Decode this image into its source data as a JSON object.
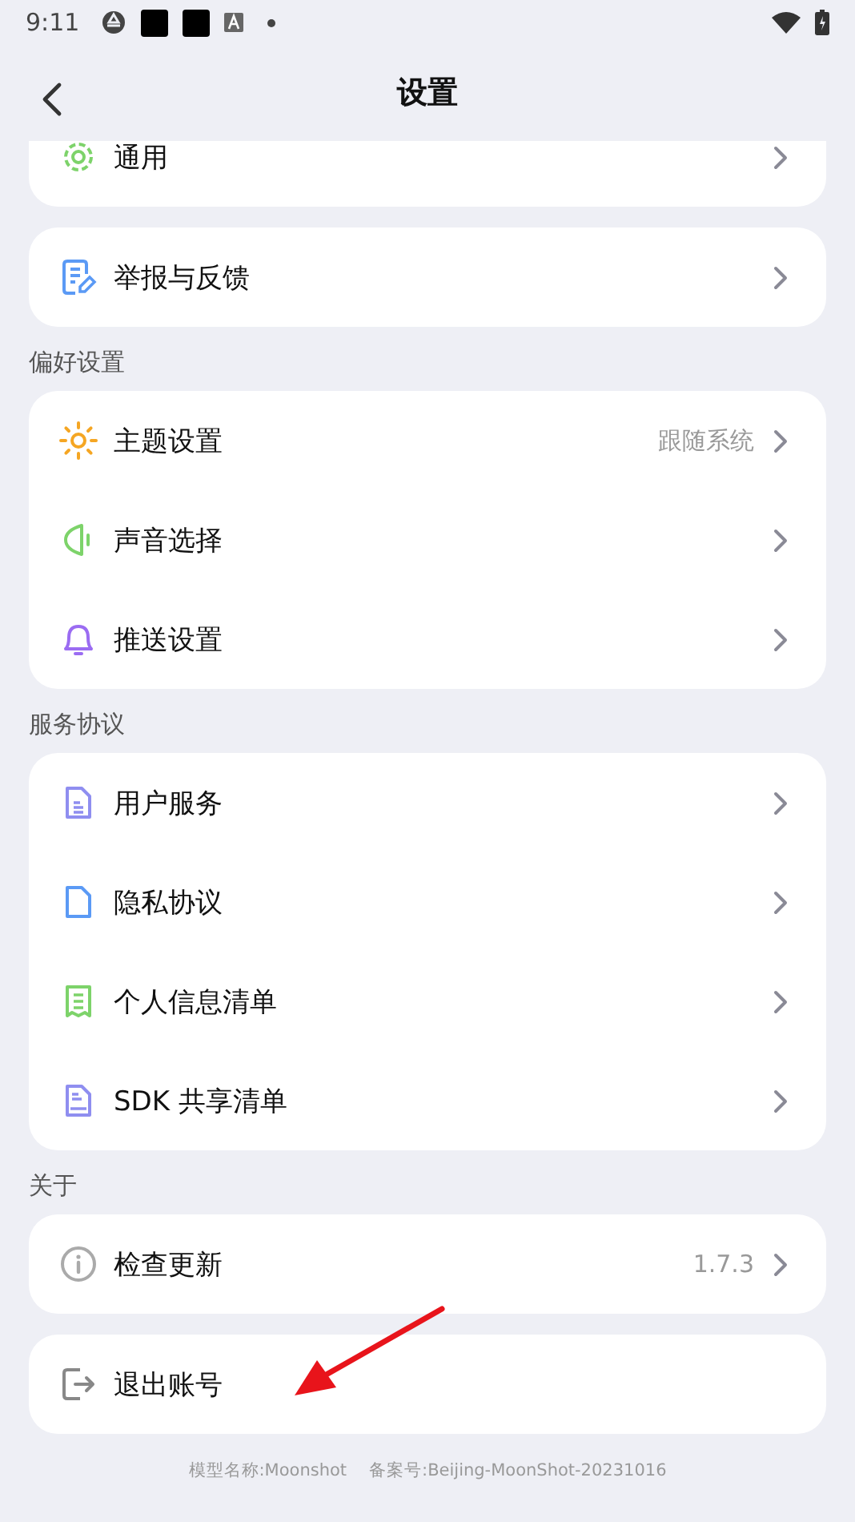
{
  "status_bar": {
    "time": "9:11"
  },
  "header": {
    "title": "设置"
  },
  "cards": [
    {
      "items": [
        {
          "kind": "link",
          "label": "通用"
        }
      ]
    },
    {
      "items": [
        {
          "kind": "link",
          "label": "举报与反馈"
        }
      ]
    },
    {
      "heading": "偏好设置",
      "items": [
        {
          "kind": "link",
          "label": "主题设置",
          "value": "跟随系统"
        },
        {
          "kind": "link",
          "label": "声音选择"
        },
        {
          "kind": "link",
          "label": "推送设置"
        }
      ]
    },
    {
      "heading": "服务协议",
      "items": [
        {
          "kind": "link",
          "label": "用户服务"
        },
        {
          "kind": "link",
          "label": "隐私协议"
        },
        {
          "kind": "link",
          "label": "个人信息清单"
        },
        {
          "kind": "link",
          "label": "SDK 共享清单"
        }
      ]
    },
    {
      "heading": "关于",
      "items": [
        {
          "kind": "link",
          "label": "检查更新",
          "value": "1.7.3"
        }
      ]
    },
    {
      "items": [
        {
          "kind": "action",
          "label": "退出账号"
        }
      ]
    }
  ],
  "footer": {
    "model": "模型名称:Moonshot",
    "record": "备案号:Beijing-MoonShot-20231016"
  }
}
